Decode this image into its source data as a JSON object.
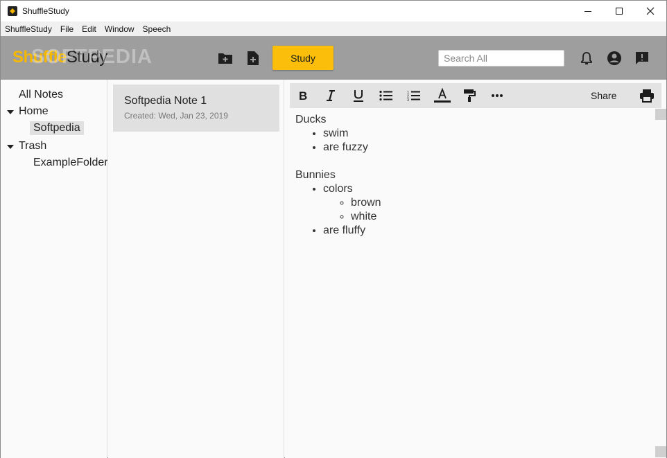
{
  "window": {
    "title": "ShuffleStudy"
  },
  "menu": [
    "ShuffleStudy",
    "File",
    "Edit",
    "Window",
    "Speech"
  ],
  "header": {
    "logo_shuffle": "Shuffle",
    "logo_study": "Study",
    "watermark": "SOFTPEDIA",
    "study_label": "Study",
    "search_placeholder": "Search All"
  },
  "sidebar": {
    "all_notes": "All Notes",
    "home": "Home",
    "home_child": "Softpedia",
    "trash": "Trash",
    "trash_child": "ExampleFolder"
  },
  "notes": [
    {
      "title": "Softpedia Note 1",
      "created": "Created: Wed, Jan 23, 2019"
    }
  ],
  "editor": {
    "share_label": "Share",
    "content": {
      "ducks": "Ducks",
      "ducks_items": [
        "swim",
        "are fuzzy"
      ],
      "bunnies": "Bunnies",
      "colors": "colors",
      "color_items": [
        "brown",
        "white"
      ],
      "fluffy": "are fluffy"
    }
  },
  "colors": {
    "accent": "#fbbf0b",
    "header_bg": "#9e9e9e",
    "logo_yellow": "#f5b800"
  },
  "icons": [
    "new-folder-icon",
    "new-note-icon",
    "bell-icon",
    "account-icon",
    "feedback-icon",
    "bold-icon",
    "italic-icon",
    "underline-icon",
    "bullet-list-icon",
    "numbered-list-icon",
    "text-color-icon",
    "format-paint-icon",
    "more-icon",
    "print-icon"
  ]
}
